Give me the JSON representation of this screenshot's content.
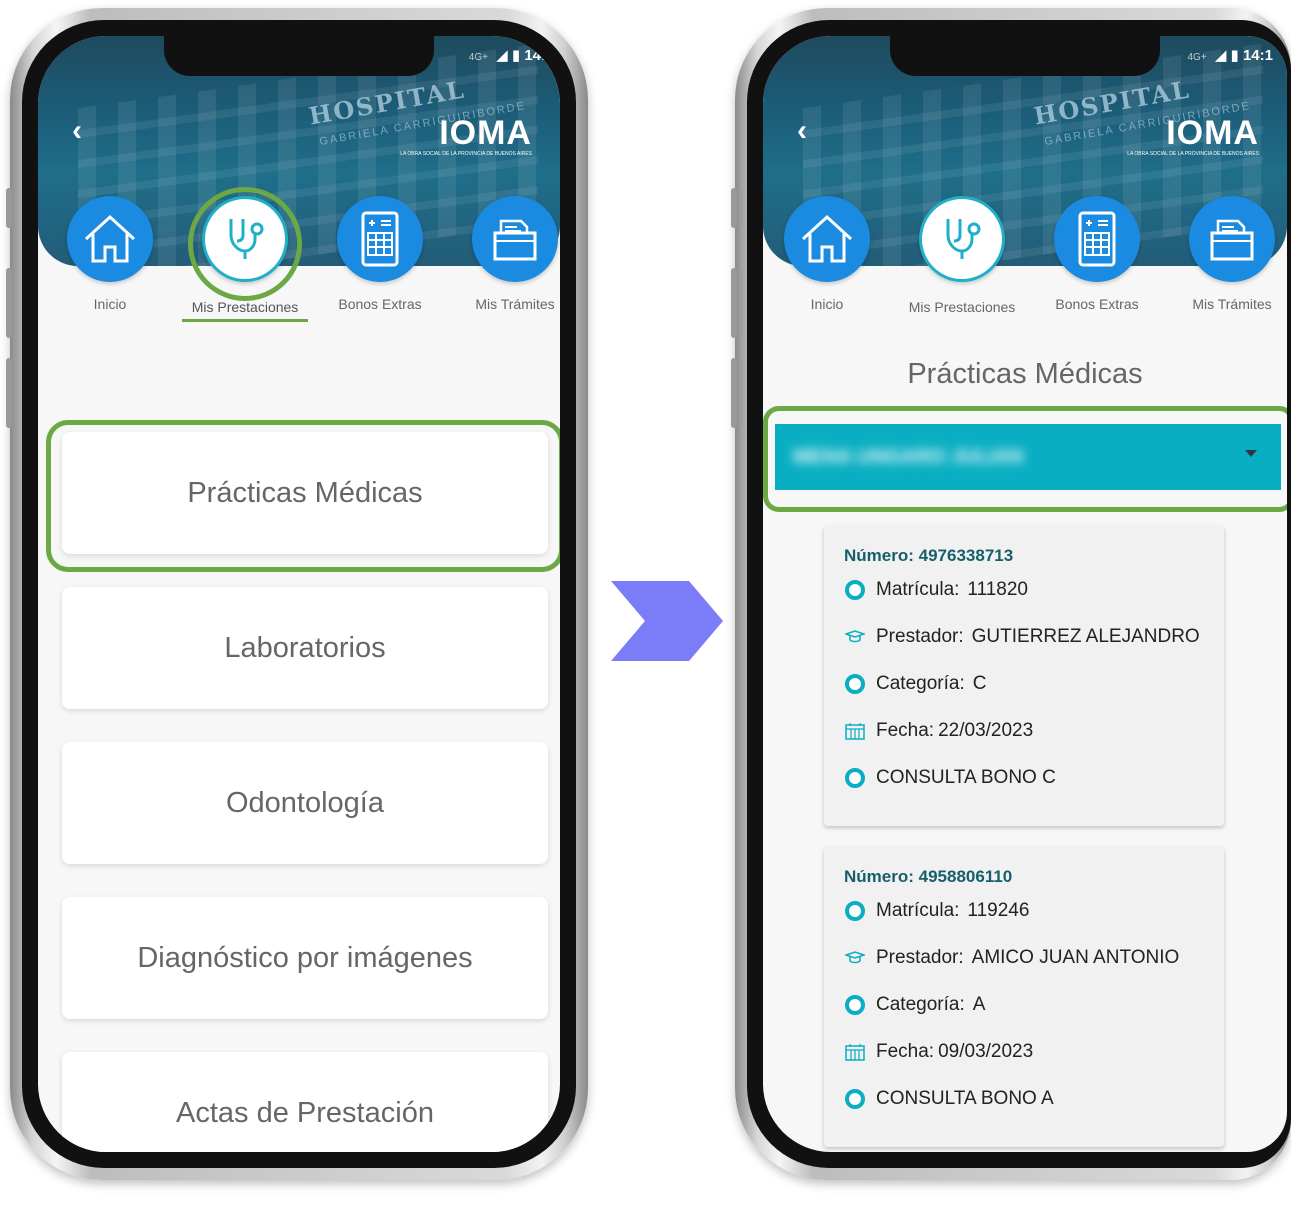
{
  "left_screen": {
    "status_network": "4G+",
    "status_time": "14:",
    "hospital_name": "HOSPITAL",
    "hospital_sub": "GABRIELA CARRIGUIRIBORDE",
    "logo": "IOMA",
    "logo_tag": "LA OBRA SOCIAL DE LA PROVINCIA DE BUENOS AIRES",
    "nav": [
      {
        "label": "Inicio",
        "icon": "house-icon"
      },
      {
        "label": "Mis Prestaciones",
        "icon": "stethoscope-icon"
      },
      {
        "label": "Bonos Extras",
        "icon": "tablet-calculator-icon"
      },
      {
        "label": "Mis Trámites",
        "icon": "folder-documents-icon"
      }
    ],
    "menu": [
      "Prácticas Médicas",
      "Laboratorios",
      "Odontología",
      "Diagnóstico por imágenes",
      "Actas de Prestación"
    ]
  },
  "right_screen": {
    "status_network": "4G+",
    "status_time": "14:1",
    "hospital_name": "HOSPITAL",
    "hospital_sub": "GABRIELA CARRIGUIRIBORDE",
    "logo": "IOMA",
    "logo_tag": "LA OBRA SOCIAL DE LA PROVINCIA DE BUENOS AIRES",
    "nav": [
      {
        "label": "Inicio",
        "icon": "house-icon"
      },
      {
        "label": "Mis Prestaciones",
        "icon": "stethoscope-icon"
      },
      {
        "label": "Bonos Extras",
        "icon": "tablet-calculator-icon"
      },
      {
        "label": "Mis Trámites",
        "icon": "folder-documents-icon"
      }
    ],
    "section_title": "Prácticas Médicas",
    "dropdown_value": "MENA UNGARO JULIAN",
    "results": [
      {
        "numero_label": "Número:",
        "numero": "4976338713",
        "matricula_label": "Matrícula:",
        "matricula": "111820",
        "prestador_label": "Prestador:",
        "prestador": "GUTIERREZ ALEJANDRO",
        "categoria_label": "Categoría:",
        "categoria": "C",
        "fecha_label": "Fecha:",
        "fecha": "22/03/2023",
        "descripcion": "CONSULTA BONO C"
      },
      {
        "numero_label": "Número:",
        "numero": "4958806110",
        "matricula_label": "Matrícula:",
        "matricula": "119246",
        "prestador_label": "Prestador:",
        "prestador": "AMICO JUAN ANTONIO",
        "categoria_label": "Categoría:",
        "categoria": "A",
        "fecha_label": "Fecha:",
        "fecha": "09/03/2023",
        "descripcion": "CONSULTA BONO A"
      }
    ]
  },
  "colors": {
    "nav_blue": "#1a8be0",
    "teal": "#0aaec2",
    "highlight_green": "#6ca843",
    "arrow_purple": "#7b7cf7"
  }
}
